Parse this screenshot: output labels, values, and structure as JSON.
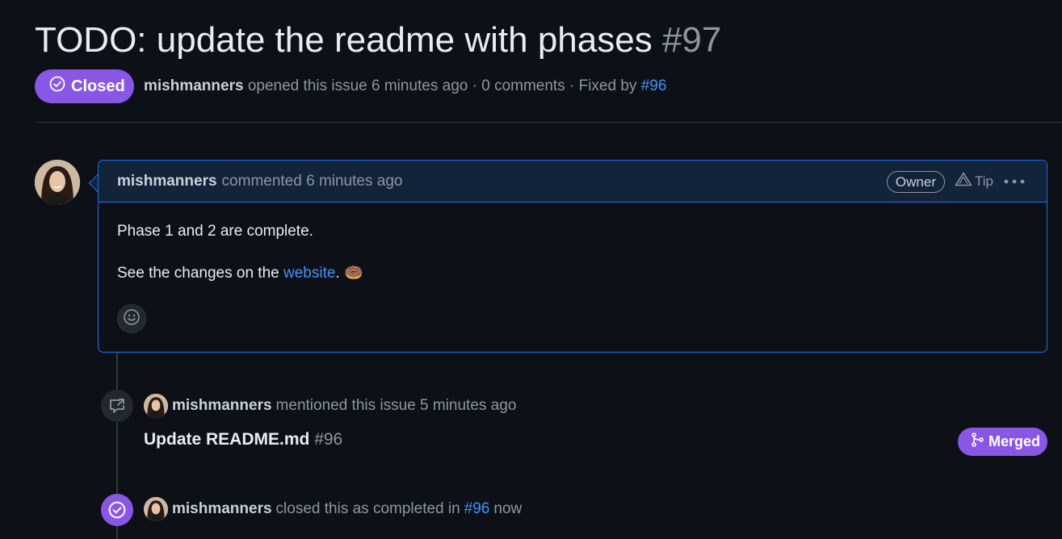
{
  "issue": {
    "title": "TODO: update the readme with phases",
    "number": "#97",
    "state": "Closed",
    "author": "mishmanners",
    "meta_text": "opened this issue 6 minutes ago · 0 comments · Fixed by",
    "fixed_by": "#96"
  },
  "comment": {
    "author": "mishmanners",
    "time_text": "commented 6 minutes ago",
    "role_badge": "Owner",
    "tip_label": "Tip",
    "body_line1": "Phase 1 and 2 are complete.",
    "body_line2_prefix": "See the changes on the",
    "body_link": "website",
    "body_line2_suffix": ". 🍩"
  },
  "events": {
    "mention": {
      "author": "mishmanners",
      "text": "mentioned this issue 5 minutes ago",
      "ref_title": "Update README.md",
      "ref_number": "#96",
      "ref_state": "Merged"
    },
    "closed": {
      "author": "mishmanners",
      "text": "closed this as completed in",
      "ref": "#96",
      "time": "now"
    }
  },
  "colors": {
    "background": "#0d1117",
    "accent_purple": "#8957e5",
    "link_blue": "#4493f8",
    "header_blue": "#132339",
    "border_blue": "#1f6feb"
  },
  "icons": [
    "check-circle-icon",
    "triangle-tip-icon",
    "kebab-icon",
    "smiley-icon",
    "cross-reference-icon",
    "merge-icon"
  ]
}
